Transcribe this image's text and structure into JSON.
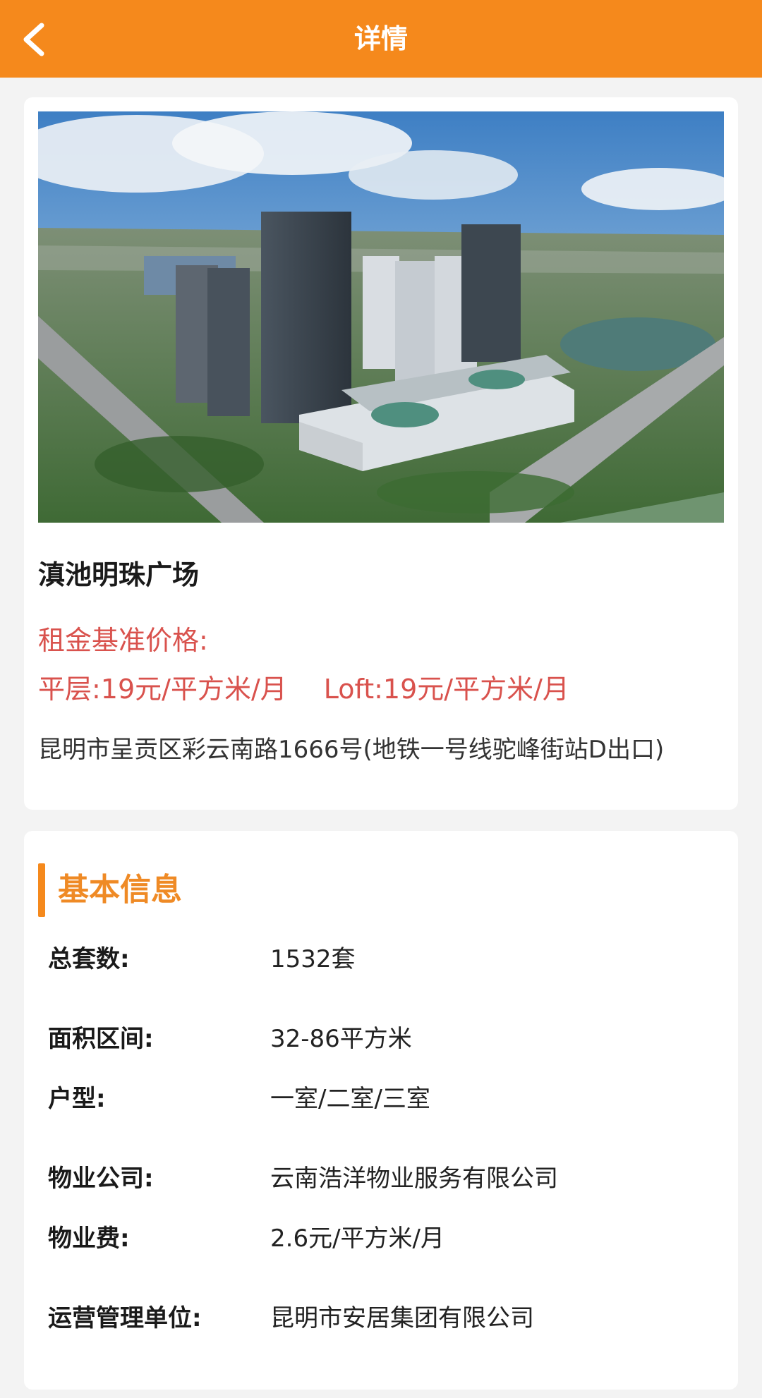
{
  "header": {
    "title": "详情",
    "back_icon": "chevron-left-icon",
    "color": "#f5891c"
  },
  "property": {
    "photo_description_icon": "building-photo",
    "name": "滇池明珠广场",
    "price_label": "租金基准价格:",
    "price_flat": "平层:19元/平方米/月",
    "price_loft": "Loft:19元/平方米/月",
    "address": "昆明市呈贡区彩云南路1666号(地铁一号线驼峰街站D出口)",
    "price_color": "#d9524d"
  },
  "basic_info": {
    "title": "基本信息",
    "accent_color": "#ef8a25",
    "rows": [
      {
        "label": "总套数:",
        "value": "1532套"
      },
      {
        "label": "面积区间:",
        "value": "32-86平方米"
      },
      {
        "label": "户型:",
        "value": "一室/二室/三室"
      },
      {
        "label": "物业公司:",
        "value": "云南浩洋物业服务有限公司"
      },
      {
        "label": "物业费:",
        "value": "2.6元/平方米/月"
      },
      {
        "label": "运营管理单位:",
        "value": "昆明市安居集团有限公司"
      }
    ]
  }
}
